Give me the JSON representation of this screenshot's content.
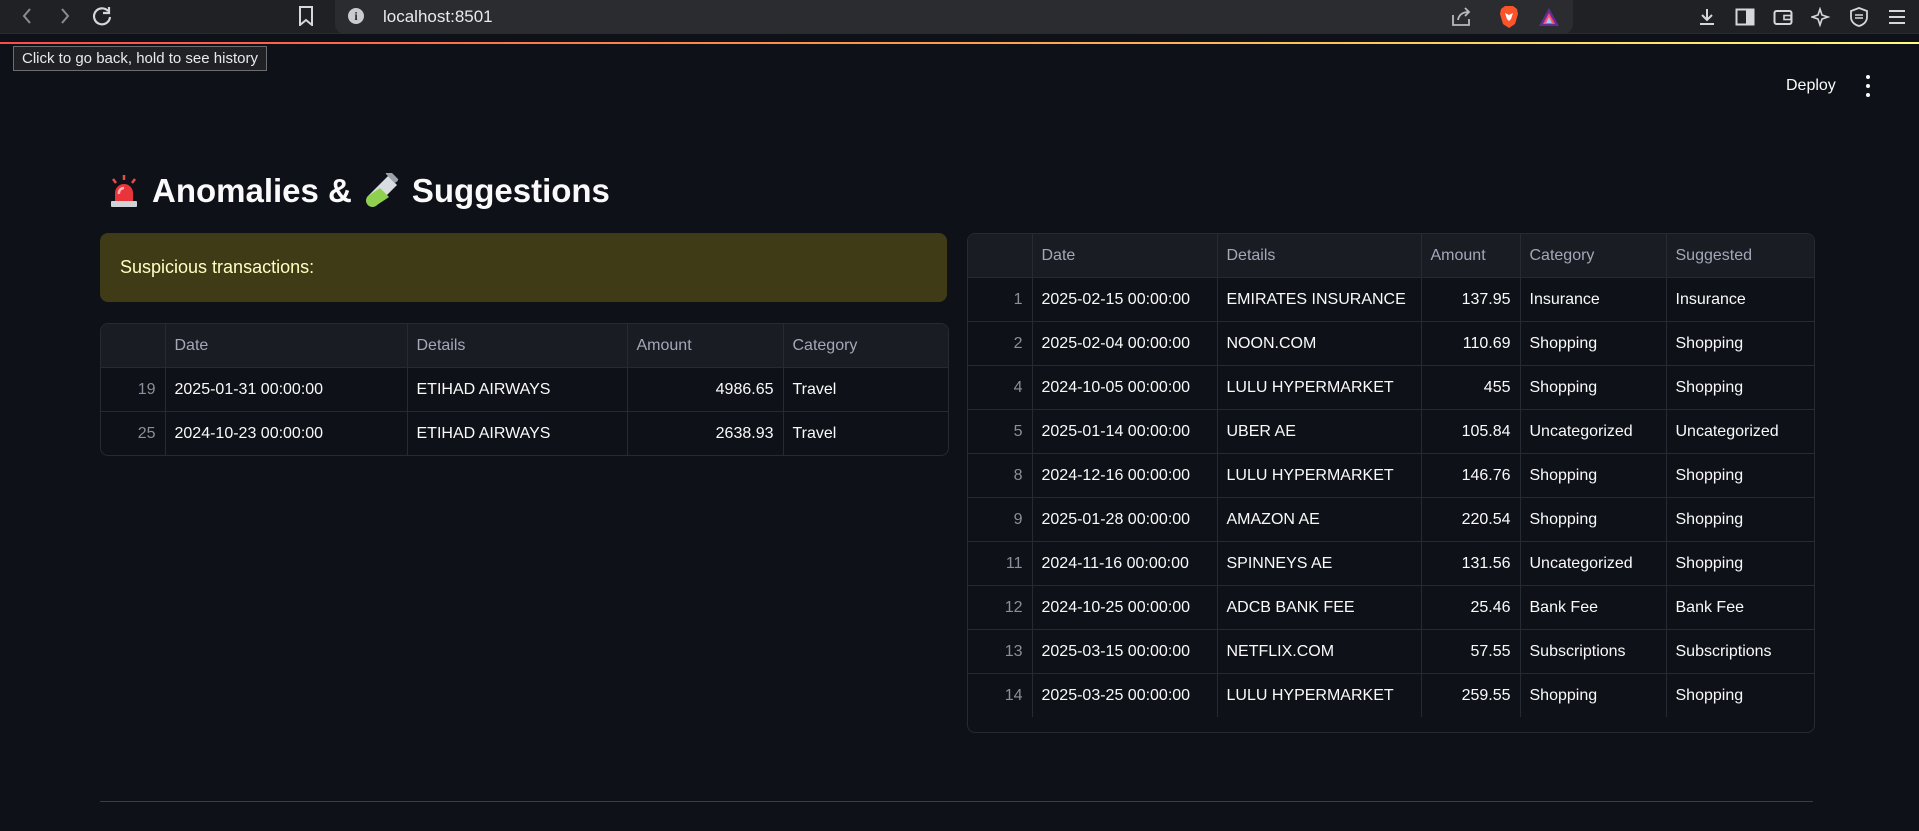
{
  "browser": {
    "url": "localhost:8501",
    "tooltip": "Click to go back, hold to see history",
    "icons": [
      "back-icon",
      "forward-icon",
      "reload-icon",
      "bookmark-icon",
      "info-icon",
      "share-icon",
      "brave-shield-icon",
      "brave-rewards-icon",
      "download-icon",
      "sidebar-icon",
      "wallet-icon",
      "leo-ai-icon",
      "vpn-icon",
      "menu-icon"
    ]
  },
  "header": {
    "deploy_label": "Deploy"
  },
  "page": {
    "title_part1": "Anomalies &",
    "title_part2": "Suggestions",
    "alert_text": "Suspicious transactions:",
    "colors": {
      "background": "#0e1117",
      "alert_bg": "#3e3b16",
      "alert_text": "#ffffc2"
    }
  },
  "anomalies_table": {
    "columns": [
      "",
      "Date",
      "Details",
      "Amount",
      "Category"
    ],
    "rows": [
      [
        "19",
        "2025-01-31 00:00:00",
        "ETIHAD AIRWAYS",
        "4986.65",
        "Travel"
      ],
      [
        "25",
        "2024-10-23 00:00:00",
        "ETIHAD AIRWAYS",
        "2638.93",
        "Travel"
      ]
    ]
  },
  "suggestions_table": {
    "columns": [
      "",
      "Date",
      "Details",
      "Amount",
      "Category",
      "Suggested"
    ],
    "rows": [
      [
        "1",
        "2025-02-15 00:00:00",
        "EMIRATES INSURANCE",
        "137.95",
        "Insurance",
        "Insurance"
      ],
      [
        "2",
        "2025-02-04 00:00:00",
        "NOON.COM",
        "110.69",
        "Shopping",
        "Shopping"
      ],
      [
        "4",
        "2024-10-05 00:00:00",
        "LULU HYPERMARKET",
        "455",
        "Shopping",
        "Shopping"
      ],
      [
        "5",
        "2025-01-14 00:00:00",
        "UBER AE",
        "105.84",
        "Uncategorized",
        "Uncategorized"
      ],
      [
        "8",
        "2024-12-16 00:00:00",
        "LULU HYPERMARKET",
        "146.76",
        "Shopping",
        "Shopping"
      ],
      [
        "9",
        "2025-01-28 00:00:00",
        "AMAZON AE",
        "220.54",
        "Shopping",
        "Shopping"
      ],
      [
        "11",
        "2024-11-16 00:00:00",
        "SPINNEYS AE",
        "131.56",
        "Uncategorized",
        "Shopping"
      ],
      [
        "12",
        "2024-10-25 00:00:00",
        "ADCB BANK FEE",
        "25.46",
        "Bank Fee",
        "Bank Fee"
      ],
      [
        "13",
        "2025-03-15 00:00:00",
        "NETFLIX.COM",
        "57.55",
        "Subscriptions",
        "Subscriptions"
      ],
      [
        "14",
        "2025-03-25 00:00:00",
        "LULU HYPERMARKET",
        "259.55",
        "Shopping",
        "Shopping"
      ]
    ]
  }
}
